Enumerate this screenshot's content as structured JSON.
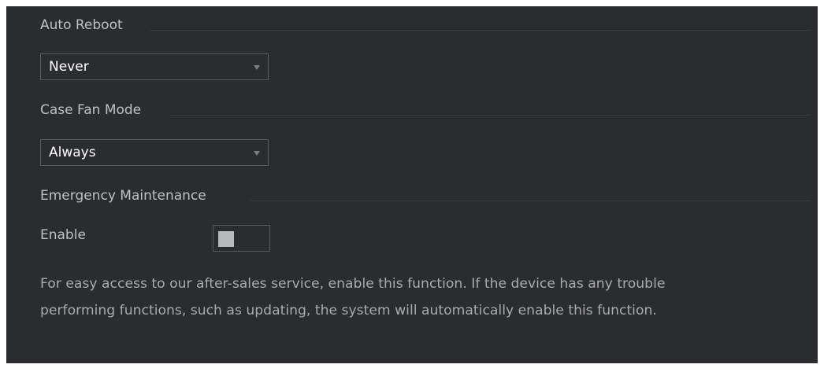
{
  "auto_reboot": {
    "title": "Auto Reboot",
    "selected": "Never"
  },
  "case_fan_mode": {
    "title": "Case Fan Mode",
    "selected": "Always"
  },
  "emergency_maintenance": {
    "title": "Emergency Maintenance",
    "enable_label": "Enable",
    "enabled": false,
    "description_line1": "For easy access to our after-sales service, enable this function. If the device has any trouble",
    "description_line2": "performing functions, such as updating, the system will automatically enable this function."
  },
  "colors": {
    "panel_bg": "#2b2c2f",
    "border": "#5a5b5f",
    "text": "#bfc0c2"
  },
  "icons": {
    "dropdown": "chevron-down-icon"
  }
}
